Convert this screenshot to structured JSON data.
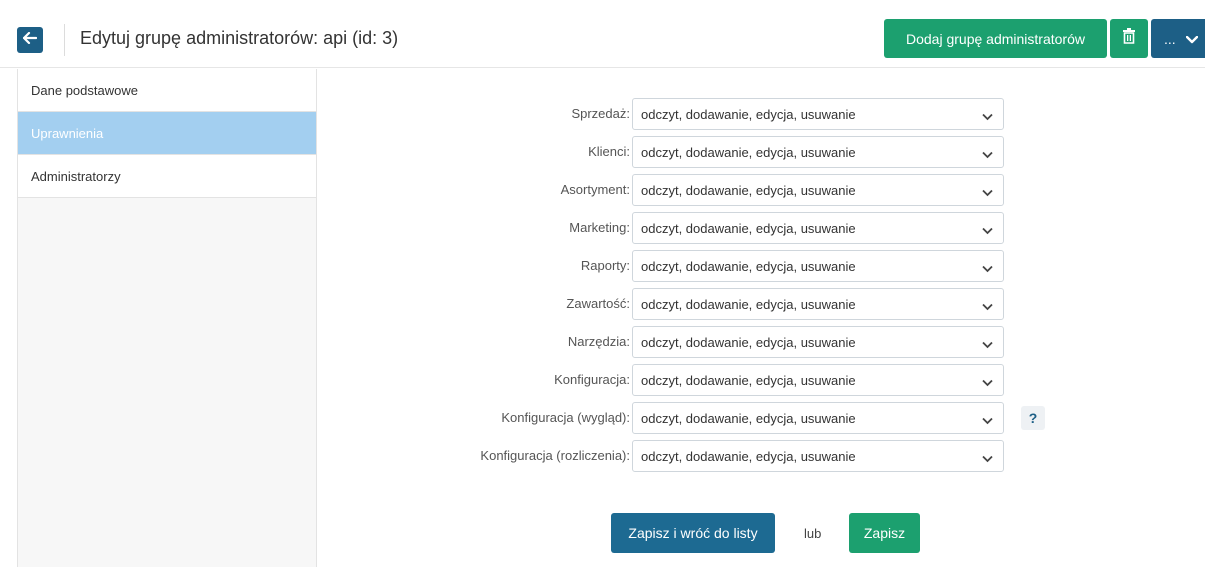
{
  "header": {
    "title": "Edytuj grupę administratorów: api (id: 3)",
    "add_label": "Dodaj grupę administratorów",
    "more_label": "..."
  },
  "sidebar": {
    "items": [
      {
        "label": "Dane podstawowe",
        "active": false
      },
      {
        "label": "Uprawnienia",
        "active": true
      },
      {
        "label": "Administratorzy",
        "active": false
      }
    ]
  },
  "permissions": [
    {
      "label": "Sprzedaż:",
      "value": "odczyt, dodawanie, edycja, usuwanie"
    },
    {
      "label": "Klienci:",
      "value": "odczyt, dodawanie, edycja, usuwanie"
    },
    {
      "label": "Asortyment:",
      "value": "odczyt, dodawanie, edycja, usuwanie"
    },
    {
      "label": "Marketing:",
      "value": "odczyt, dodawanie, edycja, usuwanie"
    },
    {
      "label": "Raporty:",
      "value": "odczyt, dodawanie, edycja, usuwanie"
    },
    {
      "label": "Zawartość:",
      "value": "odczyt, dodawanie, edycja, usuwanie"
    },
    {
      "label": "Narzędzia:",
      "value": "odczyt, dodawanie, edycja, usuwanie"
    },
    {
      "label": "Konfiguracja:",
      "value": "odczyt, dodawanie, edycja, usuwanie"
    },
    {
      "label": "Konfiguracja (wygląd):",
      "value": "odczyt, dodawanie, edycja, usuwanie",
      "help": "?"
    },
    {
      "label": "Konfiguracja (rozliczenia):",
      "value": "odczyt, dodawanie, edycja, usuwanie"
    }
  ],
  "footer": {
    "save_back_label": "Zapisz i wróć do listy",
    "or_label": "lub",
    "save_label": "Zapisz"
  },
  "colors": {
    "primary_blue": "#1d5f86",
    "green": "#1ca06f",
    "sidebar_active": "#a3cff0"
  }
}
